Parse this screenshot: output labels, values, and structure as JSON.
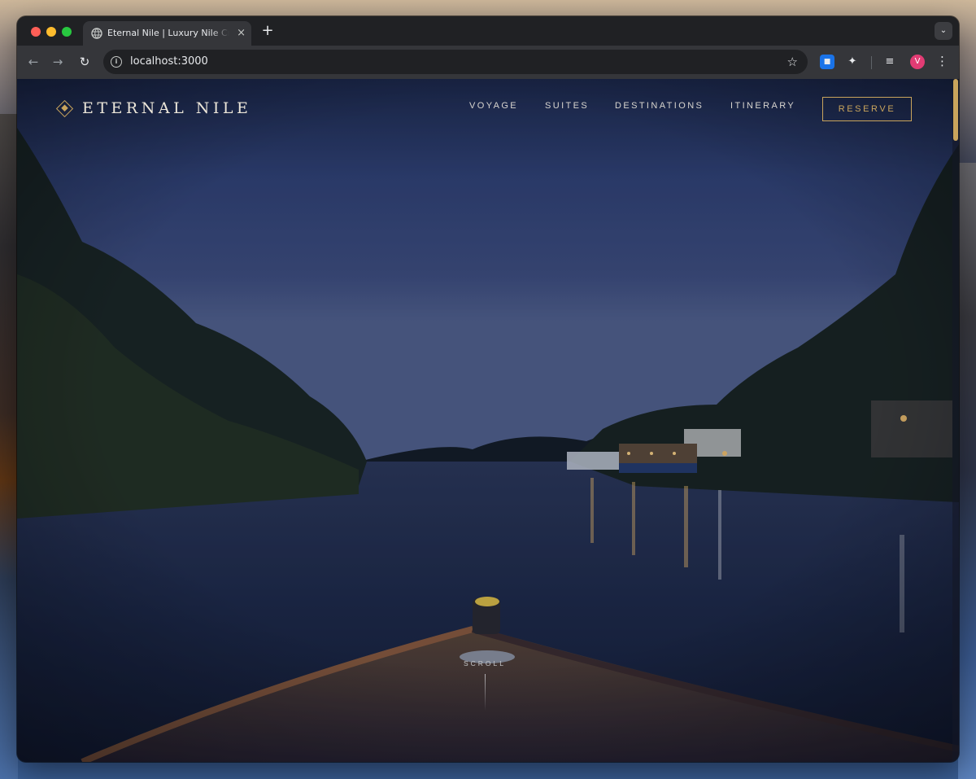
{
  "browser": {
    "tab_title": "Eternal Nile | Luxury Nile Cruise",
    "tab_close_icon": "×",
    "new_tab_icon": "+",
    "url": "localhost:3000",
    "profile_initial": "V"
  },
  "site": {
    "brand": "ETERNAL NILE",
    "nav": {
      "voyage": "VOYAGE",
      "suites": "SUITES",
      "destinations": "DESTINATIONS",
      "itinerary": "ITINERARY"
    },
    "reserve": "RESERVE",
    "scroll_label": "SCROLL"
  },
  "colors": {
    "accent_gold": "#c9a45c",
    "sky_top": "#1b2748",
    "water": "#15213a"
  }
}
